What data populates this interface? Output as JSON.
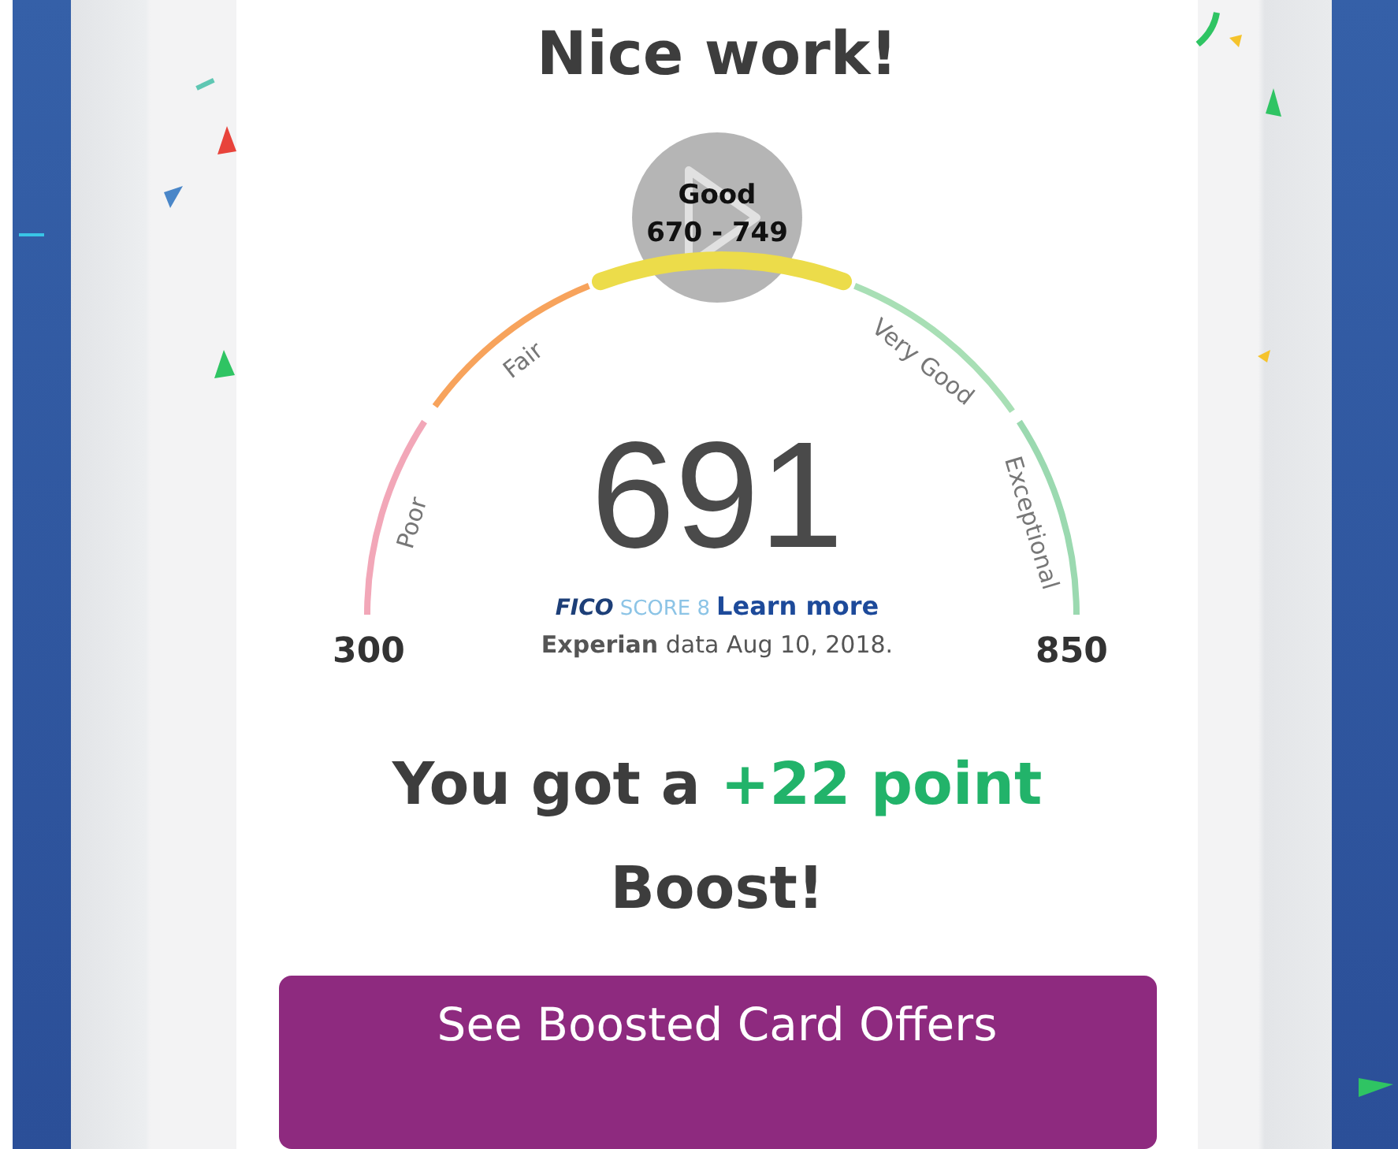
{
  "heading": "Nice work!",
  "gauge": {
    "min": "300",
    "max": "850",
    "score": "691",
    "segments": [
      {
        "label": "Poor",
        "color": "#f2a7b8",
        "selected": false
      },
      {
        "label": "Fair",
        "color": "#f7a35c",
        "selected": false
      },
      {
        "label": "Very Good",
        "color": "#a8dfb5",
        "selected": false
      },
      {
        "label": "Exceptional",
        "color": "#9bd9b0",
        "selected": false
      }
    ],
    "current": {
      "title": "Good",
      "range": "670 - 749",
      "color": "#ecdc4a",
      "selected": true
    },
    "brand": "FICO",
    "brand_suffix": "SCORE 8",
    "link": "Learn more",
    "source": "**Experian** data Aug 10, 2018."
  },
  "boost": {
    "prefix": "You got a",
    "highlight": "+22 point",
    "suffix": "Boost!"
  },
  "button": "See Boosted Card Offers"
}
